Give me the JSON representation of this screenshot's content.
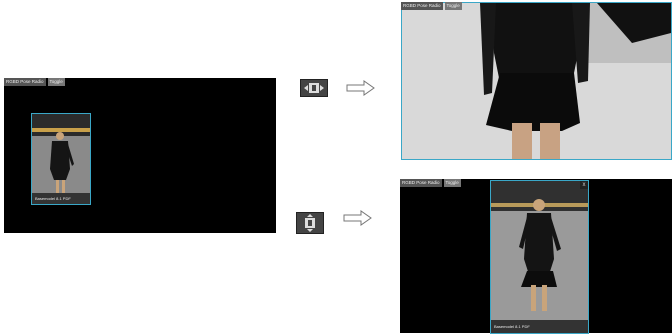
{
  "toolbar": {
    "btn1": "RGBD Pose Radio",
    "btn2": "Toggle"
  },
  "thumbnail": {
    "caption": "Basemodel 8.1 PDF"
  },
  "expanded_bottom": {
    "caption": "Basemodel 8.1 PDF",
    "close_glyph": "x"
  },
  "icons": {
    "mode_wide": "fit-width-icon",
    "mode_tall": "fit-height-icon",
    "arrow": "right-arrow-icon"
  },
  "colors": {
    "frame": "#3aa7c7",
    "panel": "#000000",
    "caption_bg": "#333333"
  }
}
